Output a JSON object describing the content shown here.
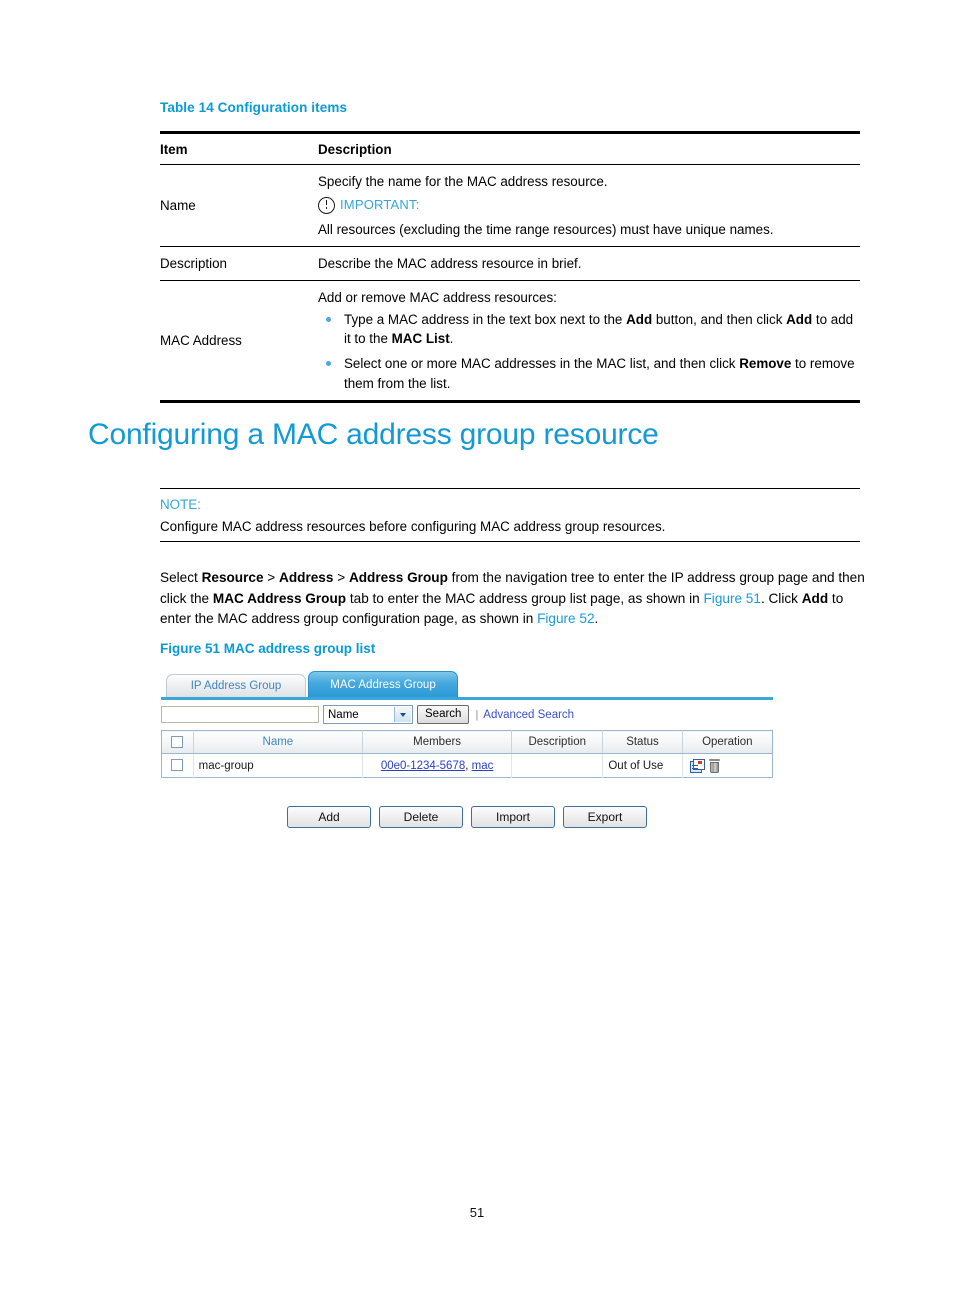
{
  "colors": {
    "accent_blue": "#0a9bd7",
    "heading_blue": "#139ad6",
    "link_blue": "#1b9ad8",
    "bullet_blue": "#4aa8dd",
    "ui_tab_active": "#2b9ad6",
    "ui_link": "#2b3fc9"
  },
  "table14": {
    "caption": "Table 14 Configuration items",
    "headers": {
      "item": "Item",
      "description": "Description"
    },
    "rows": [
      {
        "item": "Name",
        "desc_intro": "Specify the name for the MAC address resource.",
        "important_label": "IMPORTANT:",
        "important_icon": "exclamation-circle-icon",
        "desc_note": "All resources (excluding the time range resources) must have unique names."
      },
      {
        "item": "Description",
        "desc_intro": "Describe the MAC address resource in brief."
      },
      {
        "item": "MAC Address",
        "desc_intro": "Add or remove MAC address resources:",
        "bullets": [
          {
            "p1": "Type a MAC address in the text box next to the ",
            "b1": "Add",
            "p2": " button, and then click ",
            "b2": "Add",
            "p3": " to add it to the ",
            "b3": "MAC List",
            "p4": "."
          },
          {
            "p1": "Select one or more MAC addresses in the MAC list, and then click ",
            "b1": "Remove",
            "p2": " to remove them from the list."
          }
        ]
      }
    ]
  },
  "heading": "Configuring a MAC address group resource",
  "note": {
    "label": "NOTE:",
    "text": "Configure MAC address resources before configuring MAC address group resources."
  },
  "paragraph": {
    "s1": "Select ",
    "b1": "Resource",
    "s2": " > ",
    "b2": "Address",
    "s3": " > ",
    "b3": "Address Group",
    "s4": " from the navigation tree to enter the IP address group page and then click the ",
    "b4": "MAC Address Group",
    "s5": " tab to enter the MAC address group list page, as shown in ",
    "link1": "Figure 51",
    "s6": ". Click ",
    "b5": "Add",
    "s7": " to enter the MAC address group configuration page, as shown in ",
    "link2": "Figure 52",
    "s8": "."
  },
  "figure_caption": "Figure 51 MAC address group list",
  "ui": {
    "tabs": [
      {
        "label": "IP Address Group",
        "active": false
      },
      {
        "label": "MAC Address Group",
        "active": true
      }
    ],
    "search": {
      "input_value": "",
      "placeholder": "",
      "field_select": "Name",
      "search_button": "Search",
      "advanced_link": "Advanced Search",
      "search_icon": "magnifier-icon"
    },
    "grid": {
      "columns": [
        "",
        "Name",
        "Members",
        "Description",
        "Status",
        "Operation"
      ],
      "rows": [
        {
          "checked": false,
          "name": "mac-group",
          "members": [
            {
              "text": "00e0-1234-5678",
              "link": true
            },
            {
              "text": ", ",
              "link": false
            },
            {
              "text": "mac",
              "link": true
            }
          ],
          "description": "",
          "status": "Out of Use",
          "operations": [
            "edit-icon",
            "delete-icon"
          ]
        }
      ]
    },
    "actions": [
      "Add",
      "Delete",
      "Import",
      "Export"
    ]
  },
  "page_number": "51"
}
